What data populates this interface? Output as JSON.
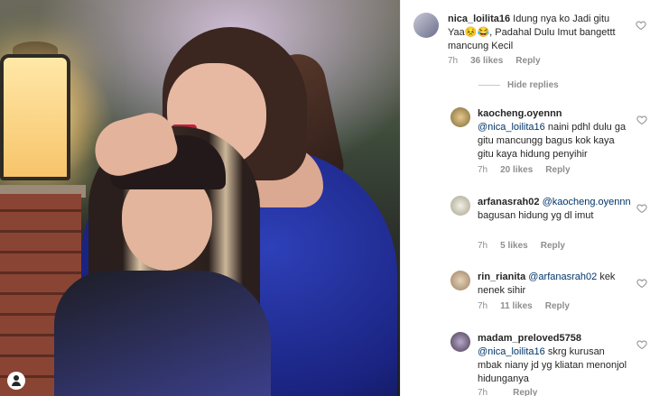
{
  "comments": [
    {
      "username": "nica_loilita16",
      "text": "Idung nya ko Jadi gitu Yaa😣😂, Padahal Dulu Imut bangettt mancung Kecil",
      "time": "7h",
      "likes": "36 likes",
      "reply": "Reply"
    },
    {
      "username": "kaocheng.oyennn",
      "mention": "@nica_loilita16",
      "text": "naini pdhl dulu ga gitu mancungg bagus kok kaya gitu kaya hidung penyihir",
      "time": "7h",
      "likes": "20 likes",
      "reply": "Reply"
    },
    {
      "username": "arfanasrah02",
      "mention": "@kaocheng.oyennn",
      "text": "bagusan hidung yg dl imut",
      "time": "7h",
      "likes": "5 likes",
      "reply": "Reply"
    },
    {
      "username": "rin_rianita",
      "mention": "@arfanasrah02",
      "text": "kek nenek sihir",
      "time": "7h",
      "likes": "11 likes",
      "reply": "Reply"
    },
    {
      "username": "madam_preloved5758",
      "mention": "@nica_loilita16",
      "text": "skrg kurusan mbak niany jd yg kliatan menonjol hidunganya",
      "time": "7h",
      "likes": "",
      "reply": "Reply"
    }
  ],
  "hide_replies_label": "Hide replies",
  "icons": {
    "like": "heart-outline-icon",
    "user": "user-tag-icon"
  },
  "colors": {
    "text": "#262626",
    "meta": "#8e8e8e",
    "mention": "#003569"
  }
}
